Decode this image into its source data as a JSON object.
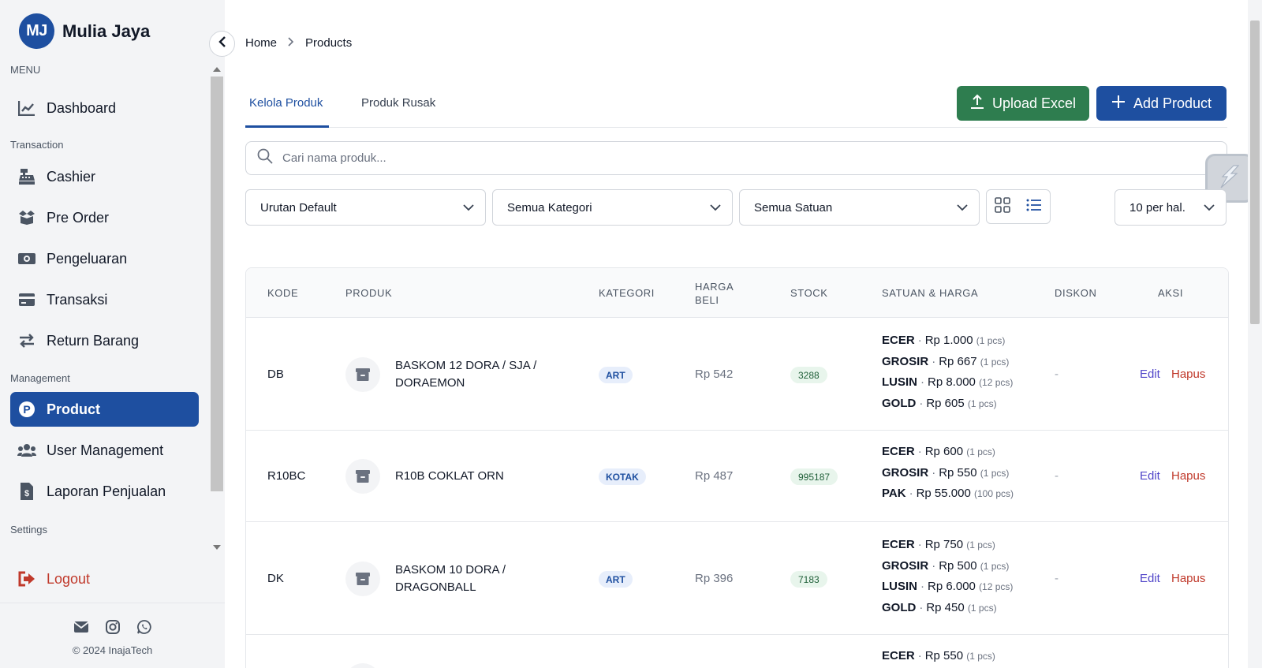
{
  "brand": {
    "initials": "MJ",
    "name": "Mulia Jaya"
  },
  "sidebar": {
    "menu_label": "MENU",
    "transaction_label": "Transaction",
    "management_label": "Management",
    "settings_label": "Settings",
    "items": [
      {
        "label": "Dashboard",
        "icon": "chart-line-icon"
      },
      {
        "label": "Cashier",
        "icon": "cash-register-icon"
      },
      {
        "label": "Pre Order",
        "icon": "box-open-icon"
      },
      {
        "label": "Pengeluaran",
        "icon": "money-bill-icon"
      },
      {
        "label": "Transaksi",
        "icon": "credit-card-icon"
      },
      {
        "label": "Return Barang",
        "icon": "exchange-icon"
      },
      {
        "label": "Product",
        "icon": "product-p-icon"
      },
      {
        "label": "User Management",
        "icon": "users-icon"
      },
      {
        "label": "Laporan Penjualan",
        "icon": "file-invoice-dollar-icon"
      }
    ],
    "logout_label": "Logout",
    "copyright": "© 2024 InajaTech"
  },
  "breadcrumb": {
    "home": "Home",
    "current": "Products"
  },
  "tabs": [
    {
      "label": "Kelola Produk"
    },
    {
      "label": "Produk Rusak"
    }
  ],
  "actions": {
    "upload_label": "Upload Excel",
    "add_label": "Add Product"
  },
  "search": {
    "placeholder": "Cari nama produk..."
  },
  "filters": {
    "sort": "Urutan Default",
    "category": "Semua Kategori",
    "unit": "Semua Satuan",
    "per_page": "10 per hal."
  },
  "table": {
    "headers": {
      "code": "KODE",
      "product": "PRODUK",
      "category": "KATEGORI",
      "buy_price_line1": "HARGA",
      "buy_price_line2": "BELI",
      "stock": "STOCK",
      "units": "SATUAN & HARGA",
      "discount": "DISKON",
      "action": "AKSI"
    },
    "edit_label": "Edit",
    "delete_label": "Hapus",
    "rows": [
      {
        "code": "DB",
        "name": "BASKOM 12 DORA / SJA / DORAEMON",
        "category": "ART",
        "buy_price": "Rp 542",
        "stock": "3288",
        "discount": "-",
        "units": [
          {
            "name": "ECER",
            "price": "Rp 1.000",
            "qty": "(1 pcs)"
          },
          {
            "name": "GROSIR",
            "price": "Rp 667",
            "qty": "(1 pcs)"
          },
          {
            "name": "LUSIN",
            "price": "Rp 8.000",
            "qty": "(12 pcs)"
          },
          {
            "name": "GOLD",
            "price": "Rp 605",
            "qty": "(1 pcs)"
          }
        ]
      },
      {
        "code": "R10BC",
        "name": "R10B COKLAT ORN",
        "category": "KOTAK",
        "buy_price": "Rp 487",
        "stock": "995187",
        "discount": "-",
        "units": [
          {
            "name": "ECER",
            "price": "Rp 600",
            "qty": "(1 pcs)"
          },
          {
            "name": "GROSIR",
            "price": "Rp 550",
            "qty": "(1 pcs)"
          },
          {
            "name": "PAK",
            "price": "Rp 55.000",
            "qty": "(100 pcs)"
          }
        ]
      },
      {
        "code": "DK",
        "name": "BASKOM 10 DORA / DRAGONBALL",
        "category": "ART",
        "buy_price": "Rp 396",
        "stock": "7183",
        "discount": "-",
        "units": [
          {
            "name": "ECER",
            "price": "Rp 750",
            "qty": "(1 pcs)"
          },
          {
            "name": "GROSIR",
            "price": "Rp 500",
            "qty": "(1 pcs)"
          },
          {
            "name": "LUSIN",
            "price": "Rp 6.000",
            "qty": "(12 pcs)"
          },
          {
            "name": "GOLD",
            "price": "Rp 450",
            "qty": "(1 pcs)"
          }
        ]
      },
      {
        "units": [
          {
            "name": "ECER",
            "price": "Rp 550",
            "qty": "(1 pcs)"
          }
        ]
      }
    ]
  },
  "colors": {
    "primary": "#1e4fa0",
    "success": "#2e7d4f",
    "danger": "#c0392b",
    "link": "#5146c9"
  }
}
